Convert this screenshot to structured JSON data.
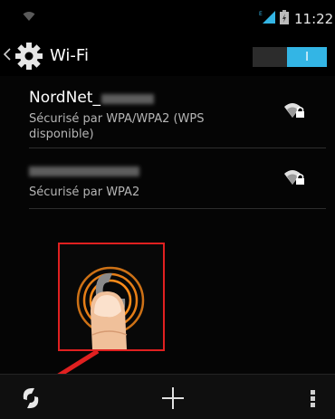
{
  "status_bar": {
    "time": "11:22",
    "icons": [
      "wifi-icon",
      "signal-icon",
      "battery-icon"
    ]
  },
  "action_bar": {
    "title": "Wi-Fi",
    "toggle_label": "I",
    "toggle_on": true,
    "icons": [
      "back-caret-icon",
      "gear-icon"
    ]
  },
  "networks": [
    {
      "name": "NordNet_",
      "name_redacted": true,
      "security": "Sécurisé par WPA/WPA2 (WPS disponible)",
      "icon": "wifi-lock-icon"
    },
    {
      "name": "",
      "name_redacted": true,
      "security": "Sécurisé par WPA2",
      "icon": "wifi-lock-icon"
    }
  ],
  "tutorial_overlay": {
    "icons": [
      "wps-icon",
      "finger-tap-icon"
    ],
    "highlight_color": "#e02020"
  },
  "bottom_bar": {
    "icons": [
      "wps-icon",
      "plus-icon",
      "overflow-menu-icon"
    ]
  },
  "colors": {
    "accent": "#33b5e5",
    "highlight": "#e02020",
    "ripple": "#ff8c1a"
  }
}
